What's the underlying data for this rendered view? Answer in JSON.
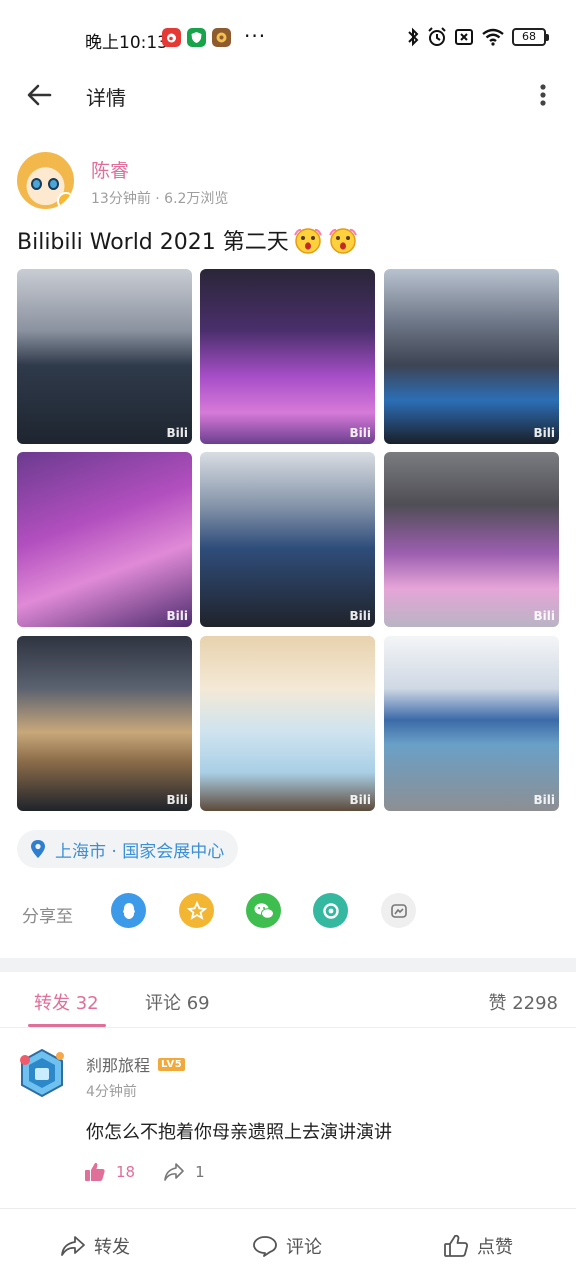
{
  "status_bar": {
    "time": "晚上10:13",
    "more": "···",
    "battery": "68"
  },
  "top_bar": {
    "title": "详情"
  },
  "post": {
    "author": "陈睿",
    "meta": "13分钟前 · 6.2万浏览",
    "text": "Bilibili World 2021 第二天",
    "watermark": "Bili",
    "location": "上海市 · 国家会展中心",
    "share_label": "分享至",
    "share_targets": [
      "qq-icon",
      "qzone-icon",
      "wechat-icon",
      "moments-icon",
      "dynamic-icon"
    ]
  },
  "tabs": {
    "repost": "转发 32",
    "comment": "评论 69",
    "likes": "赞 2298"
  },
  "comment": {
    "user": "刹那旅程",
    "level": "LV5",
    "time": "4分钟前",
    "text": "你怎么不抱着你母亲遗照上去演讲演讲",
    "likes": "18",
    "shares": "1"
  },
  "bottom_bar": {
    "repost": "转发",
    "comment": "评论",
    "like": "点赞"
  },
  "colors": {
    "accent": "#e06f9a",
    "link": "#3a8fd6"
  }
}
